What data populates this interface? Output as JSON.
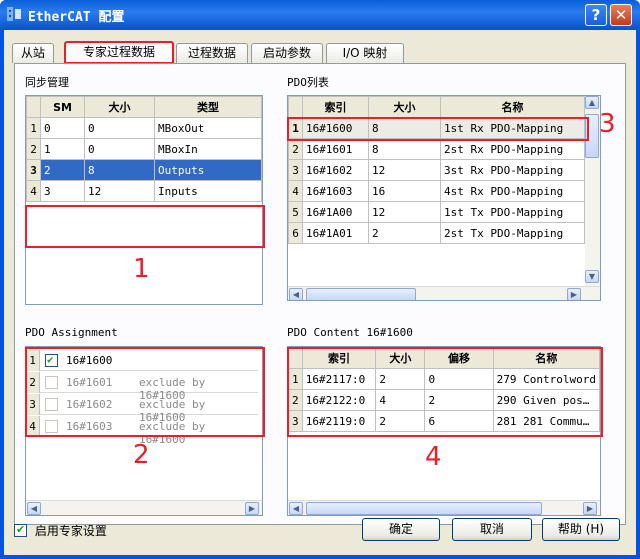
{
  "window": {
    "title": "EtherCAT 配置",
    "help_label": "?",
    "close_label": "✕"
  },
  "tabs": [
    {
      "label": "从站",
      "selected": false
    },
    {
      "label": "专家过程数据",
      "selected": true
    },
    {
      "label": "过程数据",
      "selected": false
    },
    {
      "label": "启动参数",
      "selected": false
    },
    {
      "label": "I/O 映射",
      "selected": false
    }
  ],
  "sync": {
    "label": "同步管理",
    "headers": [
      "SM",
      "大小",
      "类型"
    ],
    "rows": [
      {
        "n": "1",
        "sm": "0",
        "size": "0",
        "type": "MBoxOut"
      },
      {
        "n": "2",
        "sm": "1",
        "size": "0",
        "type": "MBoxIn"
      },
      {
        "n": "3",
        "sm": "2",
        "size": "8",
        "type": "Outputs"
      },
      {
        "n": "4",
        "sm": "3",
        "size": "12",
        "type": "Inputs"
      }
    ]
  },
  "pdolist": {
    "label": "PDO列表",
    "headers": [
      "索引",
      "大小",
      "名称"
    ],
    "rows": [
      {
        "n": "1",
        "idx": "16#1600",
        "size": "8",
        "name": "1st Rx PDO-Mapping"
      },
      {
        "n": "2",
        "idx": "16#1601",
        "size": "8",
        "name": "2st Rx PDO-Mapping"
      },
      {
        "n": "3",
        "idx": "16#1602",
        "size": "12",
        "name": "3st Rx PDO-Mapping"
      },
      {
        "n": "4",
        "idx": "16#1603",
        "size": "16",
        "name": "4st Rx PDO-Mapping"
      },
      {
        "n": "5",
        "idx": "16#1A00",
        "size": "12",
        "name": "1st Tx PDO-Mapping"
      },
      {
        "n": "6",
        "idx": "16#1A01",
        "size": "2",
        "name": "2st Tx PDO-Mapping"
      }
    ]
  },
  "assign": {
    "label": "PDO Assignment",
    "rows": [
      {
        "n": "1",
        "text": "16#1600",
        "checked": true,
        "exclude": ""
      },
      {
        "n": "2",
        "text": "16#1601",
        "checked": false,
        "exclude": "exclude by 16#1600"
      },
      {
        "n": "3",
        "text": "16#1602",
        "checked": false,
        "exclude": "exclude by 16#1600"
      },
      {
        "n": "4",
        "text": "16#1603",
        "checked": false,
        "exclude": "exclude by 16#1600"
      }
    ]
  },
  "content": {
    "label": "PDO Content 16#1600",
    "headers": [
      "索引",
      "大小",
      "偏移",
      "名称"
    ],
    "rows": [
      {
        "n": "1",
        "idx": "16#2117:0",
        "size": "2",
        "off": "0",
        "name": "279 Controlword"
      },
      {
        "n": "2",
        "idx": "16#2122:0",
        "size": "4",
        "off": "2",
        "name": "290 Given pos…"
      },
      {
        "n": "3",
        "idx": "16#2119:0",
        "size": "2",
        "off": "6",
        "name": "281 281 Commu…"
      }
    ]
  },
  "annotations": [
    "1",
    "2",
    "3",
    "4"
  ],
  "footer": {
    "expert_label": "启用专家设置",
    "ok_label": "确定",
    "cancel_label": "取消",
    "help_label": "帮助 (H)"
  }
}
